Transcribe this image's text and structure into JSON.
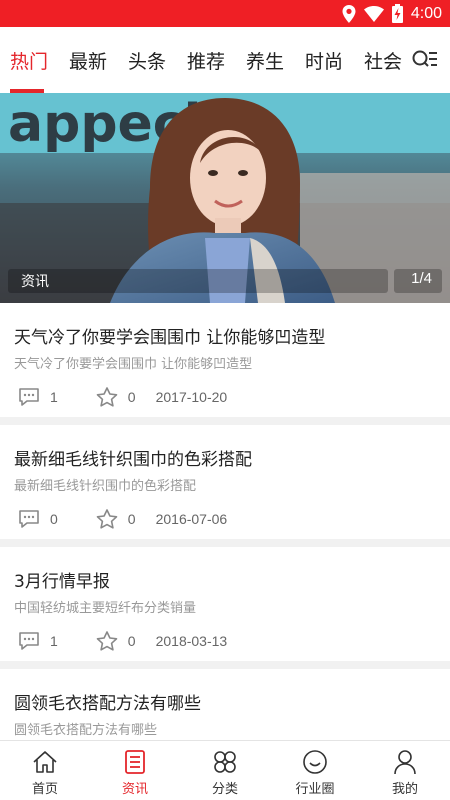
{
  "status_bar": {
    "time": "4:00",
    "icons": [
      "location-icon",
      "wifi-icon",
      "battery-charging-icon"
    ],
    "color": "#ef1f25"
  },
  "tabs": [
    {
      "label": "热门",
      "active": true
    },
    {
      "label": "最新",
      "active": false
    },
    {
      "label": "头条",
      "active": false
    },
    {
      "label": "推荐",
      "active": false
    },
    {
      "label": "养生",
      "active": false
    },
    {
      "label": "时尚",
      "active": false
    },
    {
      "label": "社会",
      "active": false
    }
  ],
  "accent_color": "#e4262b",
  "banner": {
    "tag": "资讯",
    "pager": "1/4",
    "background_text": "appecino"
  },
  "news": [
    {
      "title": "天气冷了你要学会围围巾 让你能够凹造型",
      "subtitle": "天气冷了你要学会围围巾 让你能够凹造型",
      "comments": "1",
      "favorites": "0",
      "date": "2017-10-20"
    },
    {
      "title": "最新细毛线针织围巾的色彩搭配",
      "subtitle": "最新细毛线针织围巾的色彩搭配",
      "comments": "0",
      "favorites": "0",
      "date": "2016-07-06"
    },
    {
      "title": "3月行情早报",
      "subtitle": "中国轻纺城主要短纤布分类销量",
      "comments": "1",
      "favorites": "0",
      "date": "2018-03-13"
    },
    {
      "title": "圆领毛衣搭配方法有哪些",
      "subtitle": "圆领毛衣搭配方法有哪些"
    }
  ],
  "bottom_nav": [
    {
      "label": "首页",
      "icon": "home-icon",
      "active": false
    },
    {
      "label": "资讯",
      "icon": "news-icon",
      "active": true
    },
    {
      "label": "分类",
      "icon": "category-icon",
      "active": false
    },
    {
      "label": "行业圈",
      "icon": "circle-icon",
      "active": false
    },
    {
      "label": "我的",
      "icon": "user-icon",
      "active": false
    }
  ]
}
